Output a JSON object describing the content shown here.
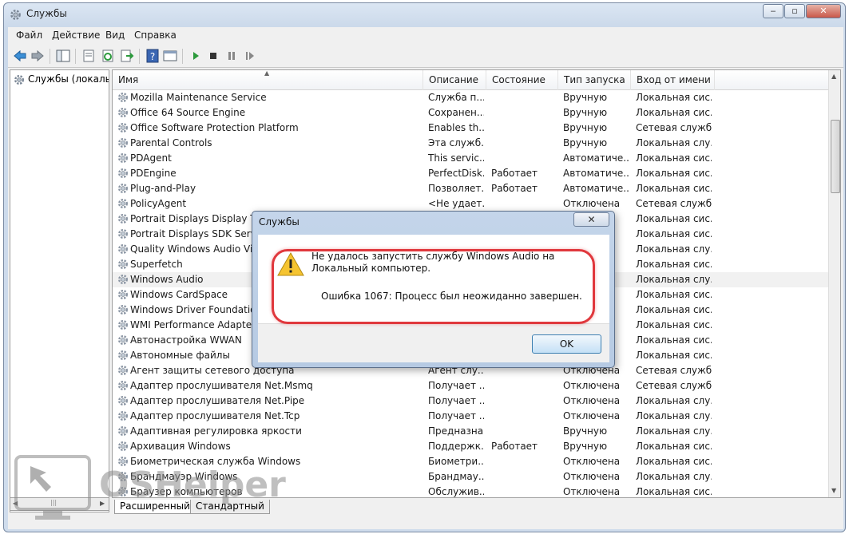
{
  "window": {
    "title": "Службы",
    "icon": "gear-icon"
  },
  "menu": [
    "Файл",
    "Действие",
    "Вид",
    "Справка"
  ],
  "toolbar": {
    "icons": [
      "back-arrow-icon",
      "forward-arrow-icon",
      "show-hide-tree-icon",
      "properties-icon",
      "refresh-icon",
      "export-icon",
      "help-icon",
      "console-icon",
      "start-icon",
      "stop-icon",
      "pause-icon",
      "restart-icon"
    ]
  },
  "tree": {
    "root": "Службы (локалы"
  },
  "table": {
    "columns": [
      "Имя",
      "Описание",
      "Состояние",
      "Тип запуска",
      "Вход от имени"
    ],
    "rows": [
      [
        "Mozilla Maintenance Service",
        "Служба п...",
        "",
        "Вручную",
        "Локальная сис..."
      ],
      [
        "Office 64 Source Engine",
        "Сохранен...",
        "",
        "Вручную",
        "Локальная сис..."
      ],
      [
        "Office Software Protection Platform",
        "Enables th...",
        "",
        "Вручную",
        "Сетевая служба"
      ],
      [
        "Parental Controls",
        "Эта служб...",
        "",
        "Вручную",
        "Локальная слу..."
      ],
      [
        "PDAgent",
        "This servic...",
        "",
        "Автоматиче...",
        "Локальная сис..."
      ],
      [
        "PDEngine",
        "PerfectDisk...",
        "Работает",
        "Автоматиче...",
        "Локальная сис..."
      ],
      [
        "Plug-and-Play",
        "Позволяет...",
        "Работает",
        "Автоматиче...",
        "Локальная сис..."
      ],
      [
        "PolicyAgent",
        "<Не удает...",
        "",
        "Отключена",
        "Сетевая служба"
      ],
      [
        "Portrait Displays Display Tune",
        "",
        "",
        "",
        "Локальная сис..."
      ],
      [
        "Portrait Displays SDK Service",
        "",
        "",
        "",
        "Локальная сис..."
      ],
      [
        "Quality Windows Audio Video",
        "",
        "",
        "",
        "Локальная слу..."
      ],
      [
        "Superfetch",
        "",
        "",
        "",
        "Локальная сис..."
      ],
      [
        "Windows Audio",
        "",
        "",
        "",
        "Локальная слу..."
      ],
      [
        "Windows CardSpace",
        "",
        "",
        "",
        "Локальная сис..."
      ],
      [
        "Windows Driver Foundation -",
        "",
        "",
        "",
        "Локальная сис..."
      ],
      [
        "WMI Performance Adapter",
        "",
        "",
        "",
        "Локальная сис..."
      ],
      [
        "Автонастройка WWAN",
        "",
        "",
        "",
        "Локальная сис..."
      ],
      [
        "Автономные файлы",
        "",
        "",
        "",
        "Локальная сис..."
      ],
      [
        "Агент защиты сетевого доступа",
        "Агент слу...",
        "",
        "Отключена",
        "Сетевая служба"
      ],
      [
        "Адаптер прослушивателя Net.Msmq",
        "Получает ...",
        "",
        "Отключена",
        "Сетевая служба"
      ],
      [
        "Адаптер прослушивателя Net.Pipe",
        "Получает ...",
        "",
        "Отключена",
        "Локальная слу..."
      ],
      [
        "Адаптер прослушивателя Net.Tcp",
        "Получает ...",
        "",
        "Отключена",
        "Локальная слу..."
      ],
      [
        "Адаптивная регулировка яркости",
        "Предназна...",
        "",
        "Вручную",
        "Локальная слу..."
      ],
      [
        "Архивация Windows",
        "Поддержк...",
        "Работает",
        "Вручную",
        "Локальная сис..."
      ],
      [
        "Биометрическая служба Windows",
        "Биометри...",
        "",
        "Отключена",
        "Локальная сис..."
      ],
      [
        "Брандмауэр Windows",
        "Брандмау...",
        "",
        "Отключена",
        "Локальная слу..."
      ],
      [
        "Браузер компьютеров",
        "Обслужив...",
        "",
        "Отключена",
        "Локальная сис..."
      ]
    ],
    "selected_row": 12
  },
  "tabs": [
    "Расширенный",
    "Стандартный"
  ],
  "dialog": {
    "title": "Службы",
    "close": "✕",
    "message": "Не удалось запустить службу Windows Audio на Локальный компьютер.",
    "error": "Ошибка 1067: Процесс был неожиданно завершен.",
    "ok": "OK",
    "icon": "warning-icon"
  },
  "watermark": {
    "text": "OSHelper",
    "icon": "cursor-monitor-icon"
  },
  "colors": {
    "highlight": "#e0383d",
    "selection": "#f1f1f1",
    "titlebar": "#cbd9ea",
    "dialog_frame": "#b6cae3"
  }
}
